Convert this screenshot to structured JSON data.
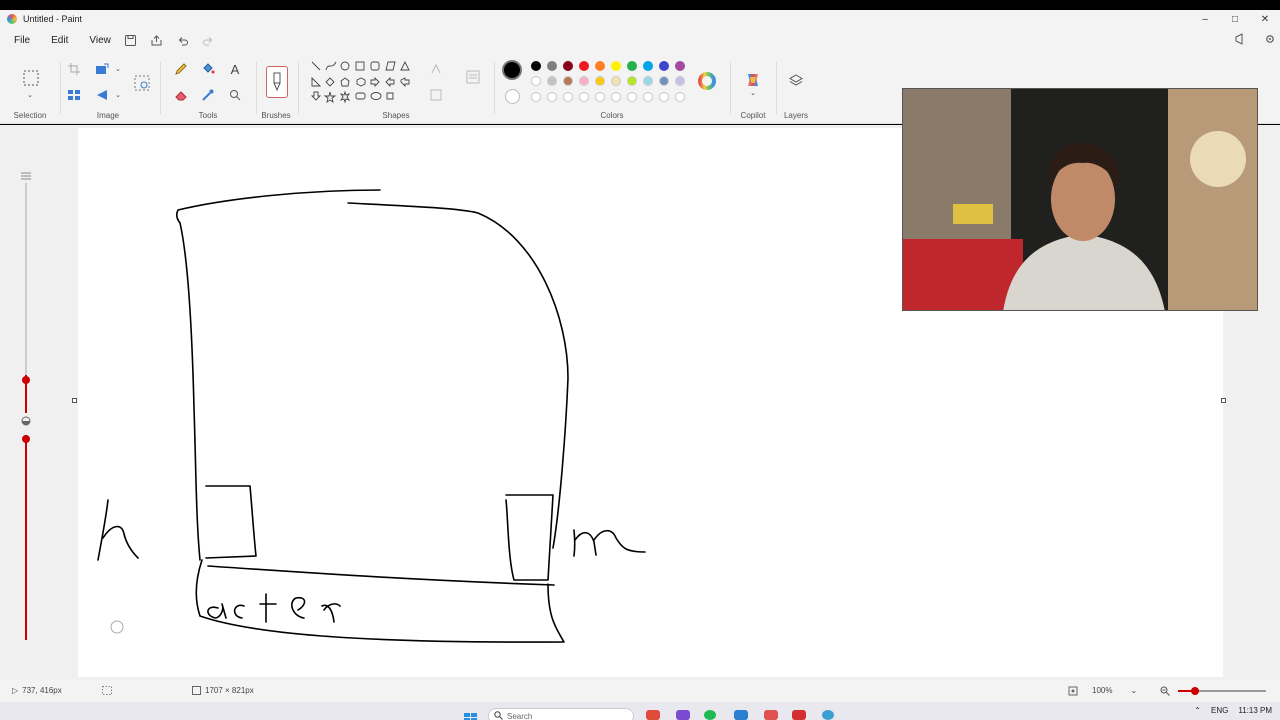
{
  "window": {
    "title": "Untitled - Paint",
    "minimize": "–",
    "maximize": "□",
    "close": "✕"
  },
  "menu": {
    "file": "File",
    "edit": "Edit",
    "view": "View"
  },
  "ribbon": {
    "groups": {
      "selection": "Selection",
      "image": "Image",
      "tools": "Tools",
      "brushes": "Brushes",
      "shapes": "Shapes",
      "colors": "Colors",
      "copilot": "Copilot",
      "layers": "Layers"
    },
    "palette_row1": [
      "#000000",
      "#7f7f7f",
      "#88001b",
      "#ed1c24",
      "#ff7f27",
      "#fff200",
      "#22b14c",
      "#00a2e8",
      "#3f48cc",
      "#a349a4"
    ],
    "palette_row2": [
      "#ffffff",
      "#c3c3c3",
      "#b97a57",
      "#ffaec9",
      "#ffc90e",
      "#efe4b0",
      "#b5e61d",
      "#99d9ea",
      "#7092be",
      "#c8bfe7"
    ],
    "primary_color": "#000000",
    "secondary_color": "#ffffff"
  },
  "drawing": {
    "text_left": "h",
    "text_right": "m",
    "text_bottom": "acter"
  },
  "status": {
    "cursor_pos": "737, 416px",
    "canvas_size": "1707 × 821px",
    "zoom": "100%"
  },
  "taskbar": {
    "search_placeholder": "Search",
    "lang": "ENG",
    "time": "11:13 PM"
  }
}
